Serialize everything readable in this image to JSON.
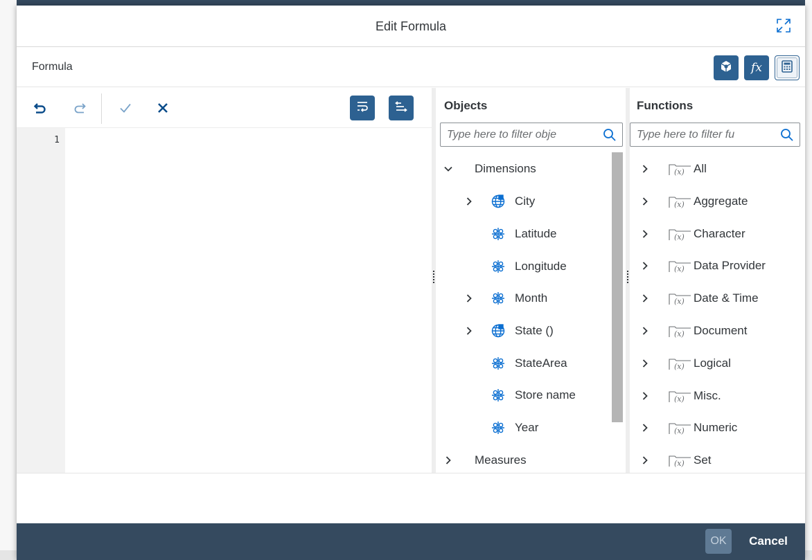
{
  "dialog": {
    "title": "Edit Formula",
    "subtitle": "Formula",
    "toolbar_buttons": [
      {
        "name": "objects-cube",
        "icon": "cube-icon"
      },
      {
        "name": "functions",
        "icon": "fx-icon",
        "label": "fx"
      },
      {
        "name": "calculator",
        "icon": "calculator-icon",
        "selected": true
      }
    ]
  },
  "editor": {
    "line_numbers": [
      "1"
    ],
    "content": "",
    "tools": [
      "undo-icon",
      "redo-icon",
      "validate-check-icon",
      "clear-x-icon",
      "word-wrap-icon",
      "indent-icon"
    ]
  },
  "objects": {
    "title": "Objects",
    "filter_placeholder": "Type here to filter obje",
    "tree": [
      {
        "label": "Dimensions",
        "expanded": true,
        "level": 0
      },
      {
        "label": "City",
        "icon": "geo-globe-icon",
        "expandable": true,
        "level": 1
      },
      {
        "label": "Latitude",
        "icon": "dimension-icon",
        "expandable": false,
        "level": 1
      },
      {
        "label": "Longitude",
        "icon": "dimension-icon",
        "expandable": false,
        "level": 1
      },
      {
        "label": "Month",
        "icon": "dimension-icon",
        "expandable": true,
        "level": 1
      },
      {
        "label": "State ()",
        "icon": "geo-globe-icon",
        "expandable": true,
        "level": 1
      },
      {
        "label": "StateArea",
        "icon": "dimension-icon",
        "expandable": false,
        "level": 1
      },
      {
        "label": "Store name",
        "icon": "dimension-icon",
        "expandable": false,
        "level": 1
      },
      {
        "label": "Year",
        "icon": "dimension-icon",
        "expandable": false,
        "level": 1
      },
      {
        "label": "Measures",
        "expanded": false,
        "level": 0
      }
    ]
  },
  "functions": {
    "title": "Functions",
    "filter_placeholder": "Type here to filter fu",
    "categories": [
      "All",
      "Aggregate",
      "Character",
      "Data Provider",
      "Date & Time",
      "Document",
      "Logical",
      "Misc.",
      "Numeric",
      "Set"
    ]
  },
  "footer": {
    "ok_label": "OK",
    "cancel_label": "Cancel"
  },
  "colors": {
    "accent": "#2d6191",
    "icon_blue": "#0a6ed1",
    "footer_bar": "#354a5f"
  }
}
